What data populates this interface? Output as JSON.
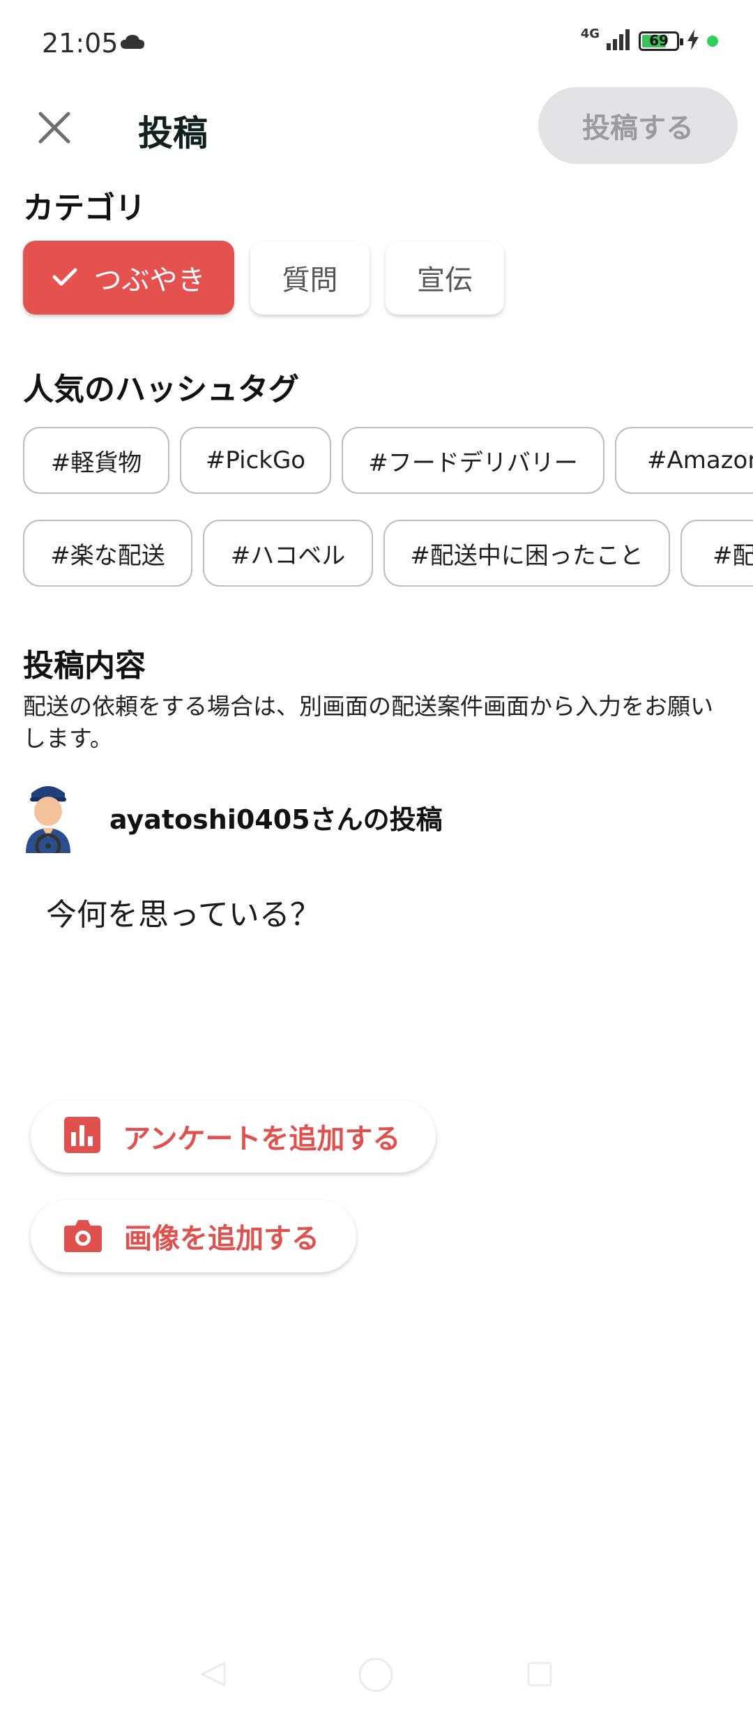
{
  "status_bar": {
    "time": "21:05",
    "network": "4G",
    "battery": "69",
    "icons": [
      "cloud-icon",
      "signal-icon",
      "battery-icon",
      "charging-icon"
    ]
  },
  "header": {
    "title": "投稿",
    "post_button": "投稿する"
  },
  "category": {
    "title": "カテゴリ",
    "options": [
      "つぶやき",
      "質問",
      "宣伝"
    ],
    "selected": "つぶやき"
  },
  "hashtags": {
    "title": "人気のハッシュタグ",
    "row1": [
      "#軽貨物",
      "#PickGo",
      "#フードデリバリー",
      "#Amazon"
    ],
    "row2": [
      "#楽な配送",
      "#ハコベル",
      "#配送中に困ったこと",
      "#配"
    ]
  },
  "content": {
    "title": "投稿内容",
    "description": "配送の依頼をする場合は、別画面の配送案件画面から入力をお願いします。",
    "user_label": "ayatoshi0405さんの投稿",
    "placeholder": "今何を思っている？"
  },
  "actions": {
    "poll": "アンケートを追加する",
    "image": "画像を追加する"
  },
  "colors": {
    "accent": "#e5514f",
    "disabled_bg": "#e3e3e5",
    "disabled_text": "#9b9b9e"
  }
}
